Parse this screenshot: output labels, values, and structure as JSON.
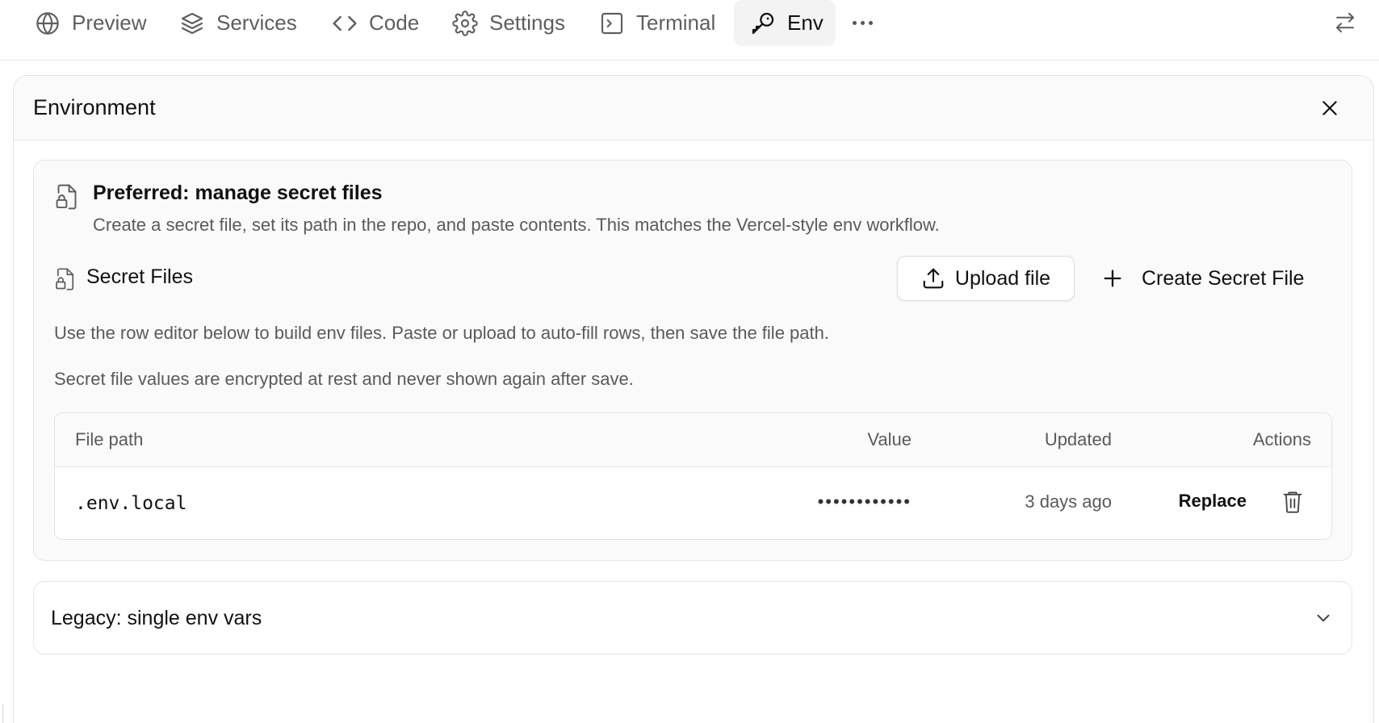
{
  "tabs": [
    {
      "label": "Preview",
      "icon": "globe-icon"
    },
    {
      "label": "Services",
      "icon": "layers-icon"
    },
    {
      "label": "Code",
      "icon": "code-icon"
    },
    {
      "label": "Settings",
      "icon": "gear-icon"
    },
    {
      "label": "Terminal",
      "icon": "terminal-icon"
    },
    {
      "label": "Env",
      "icon": "key-icon",
      "active": true
    }
  ],
  "panel": {
    "title": "Environment"
  },
  "preferred": {
    "title": "Preferred: manage secret files",
    "description": "Create a secret file, set its path in the repo, and paste contents. This matches the Vercel-style env workflow."
  },
  "secret_files": {
    "title": "Secret Files",
    "upload_label": "Upload file",
    "create_label": "Create Secret File",
    "help_text": "Use the row editor below to build env files. Paste or upload to auto-fill rows, then save the file path.",
    "security_note": "Secret file values are encrypted at rest and never shown again after save.",
    "columns": {
      "path": "File path",
      "value": "Value",
      "updated": "Updated",
      "actions": "Actions"
    },
    "rows": [
      {
        "path": ".env.local",
        "value": "••••••••••••",
        "updated": "3 days ago",
        "action_label": "Replace"
      }
    ]
  },
  "legacy": {
    "title": "Legacy: single env vars",
    "expanded": false
  }
}
